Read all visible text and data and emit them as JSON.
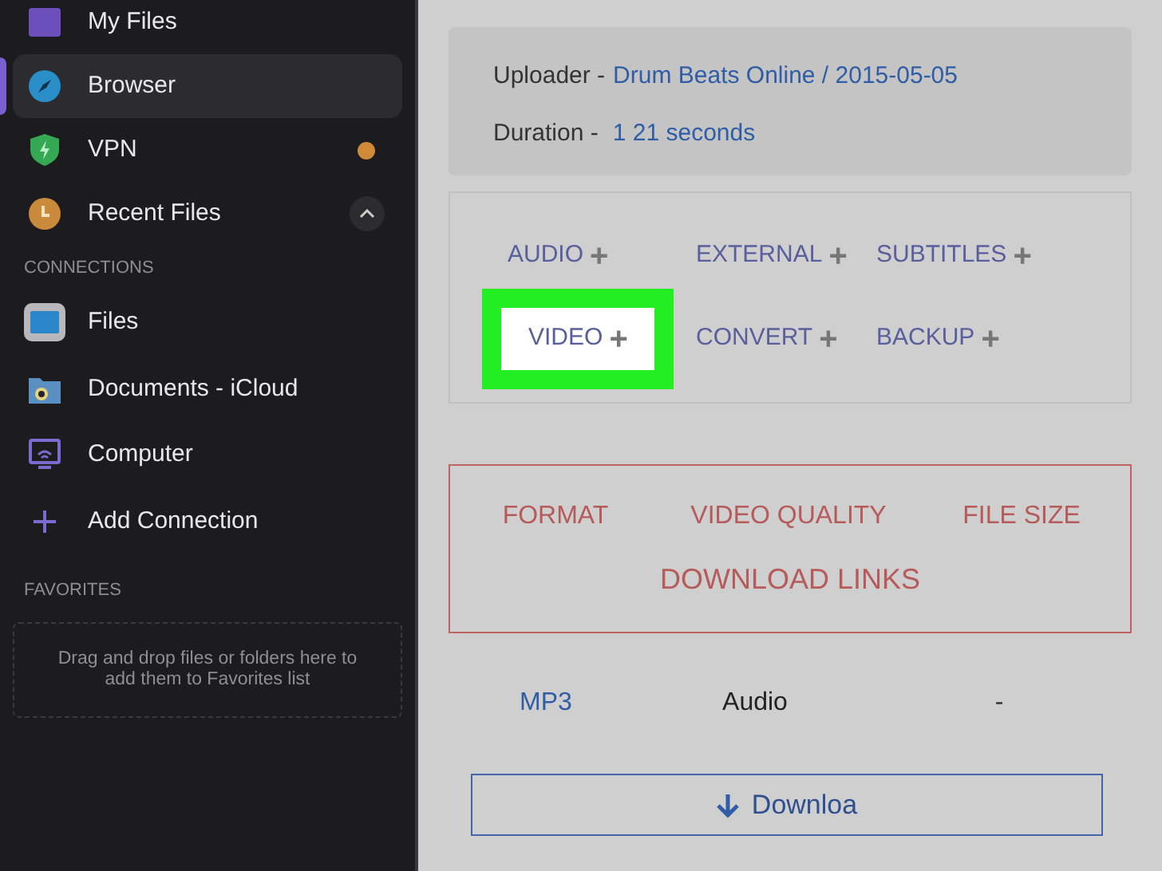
{
  "sidebar": {
    "items": [
      {
        "label": "My Files",
        "selected": false
      },
      {
        "label": "Browser",
        "selected": true
      },
      {
        "label": "VPN",
        "selected": false,
        "badge": true
      },
      {
        "label": "Recent Files",
        "selected": false,
        "expanded": true
      }
    ],
    "connections": {
      "heading": "CONNECTIONS",
      "items": [
        {
          "label": "Files"
        },
        {
          "label": "Documents - iCloud"
        },
        {
          "label": "Computer"
        },
        {
          "label": "Add Connection"
        }
      ]
    },
    "favorites": {
      "heading": "FAVORITES",
      "hint": "Drag and drop files or folders here to add them to Favorites list"
    }
  },
  "info": {
    "uploader_label": "Uploader -",
    "uploader_value": "Drum Beats Online / 2015-05-05",
    "duration_label": "Duration -",
    "duration_value": "1 21 seconds"
  },
  "tags": [
    {
      "label": "AUDIO",
      "plus": "+",
      "highlighted": false
    },
    {
      "label": "EXTERNAL",
      "plus": "+",
      "highlighted": false
    },
    {
      "label": "SUBTITLES",
      "plus": "+",
      "highlighted": false
    },
    {
      "label": "VIDEO",
      "plus": "+",
      "highlighted": true
    },
    {
      "label": "CONVERT",
      "plus": "+",
      "highlighted": false
    },
    {
      "label": "BACKUP",
      "plus": "+",
      "highlighted": false
    }
  ],
  "table": {
    "columns": [
      "FORMAT",
      "VIDEO QUALITY",
      "FILE SIZE",
      "DOWNLOAD LINKS"
    ],
    "rows": [
      {
        "cells": [
          "MP3",
          "Audio",
          "-"
        ]
      }
    ]
  },
  "download_button": {
    "label": "Downloa"
  }
}
